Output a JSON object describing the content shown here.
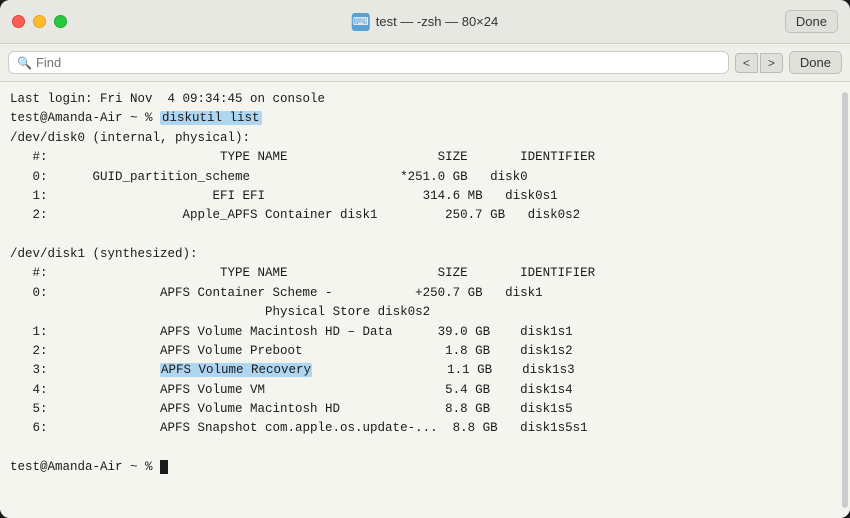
{
  "window": {
    "title": "test — -zsh — 80×24",
    "title_icon": "🖥"
  },
  "titlebar": {
    "title": "test — -zsh — 80×24",
    "done_label": "Done"
  },
  "searchbar": {
    "placeholder": "Find",
    "nav_back": "<",
    "nav_forward": ">"
  },
  "terminal": {
    "lines": [
      {
        "text": "Last login: Fri Nov  4 09:34:45 on console",
        "type": "normal"
      },
      {
        "text": "test@Amanda-Air ~ % diskutil list",
        "type": "cmd",
        "highlight_start": 19,
        "cmd_text": "diskutil list"
      },
      {
        "text": "/dev/disk0 (internal, physical):",
        "type": "normal"
      },
      {
        "text": "   #:                       TYPE NAME                    SIZE       IDENTIFIER",
        "type": "normal"
      },
      {
        "text": "   0:      GUID_partition_scheme                        *251.0 GB   disk0",
        "type": "normal"
      },
      {
        "text": "   1:                        EFI EFI                     314.6 MB   disk0s1",
        "type": "normal"
      },
      {
        "text": "   2:                  Apple_APFS Container disk1        250.7 GB   disk0s2",
        "type": "normal"
      },
      {
        "text": "",
        "type": "normal"
      },
      {
        "text": "/dev/disk1 (synthesized):",
        "type": "normal"
      },
      {
        "text": "   #:                       TYPE NAME                    SIZE       IDENTIFIER",
        "type": "normal"
      },
      {
        "text": "   0:                 APFS Container Scheme -           +250.7 GB   disk1",
        "type": "normal"
      },
      {
        "text": "                                 Physical Store disk0s2",
        "type": "normal"
      },
      {
        "text": "   1:                APFS Volume Macintosh HD - Data     39.0 GB    disk1s1",
        "type": "normal"
      },
      {
        "text": "   2:                APFS Volume Preboot                  1.8 GB    disk1s2",
        "type": "normal"
      },
      {
        "text": "   3:                APFS Volume Recovery                 1.1 GB    disk1s3",
        "type": "highlight_row"
      },
      {
        "text": "   4:                APFS Volume VM                       5.4 GB    disk1s4",
        "type": "normal"
      },
      {
        "text": "   5:                APFS Volume Macintosh HD             8.8 GB    disk1s5",
        "type": "normal"
      },
      {
        "text": "   6:               APFS Snapshot com.apple.os.update-...  8.8 GB   disk1s5s1",
        "type": "normal"
      },
      {
        "text": "",
        "type": "normal"
      },
      {
        "text": "test@Amanda-Air ~ % ",
        "type": "prompt_end"
      }
    ]
  }
}
